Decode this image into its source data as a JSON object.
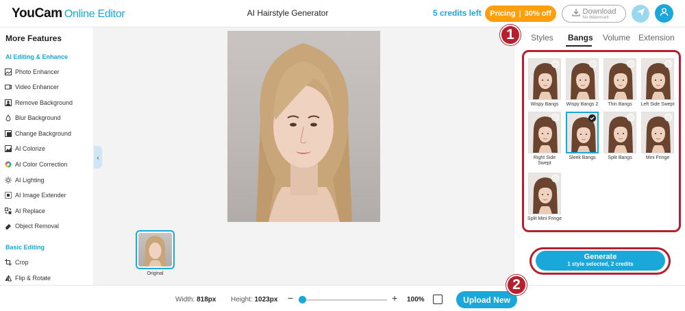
{
  "header": {
    "logo_main": "YouCam",
    "logo_sub": "Online Editor",
    "title": "AI Hairstyle Generator",
    "credits": "5 credits left",
    "pricing_label": "Pricing",
    "pricing_sep": "|",
    "pricing_discount": "30% off",
    "download_label": "Download",
    "download_sub": "No Watermark",
    "icons": {
      "download": "download-icon",
      "send": "send-icon",
      "profile": "user-icon"
    }
  },
  "sidebar": {
    "title": "More Features",
    "sections": [
      {
        "title": "AI Editing & Enhance",
        "items": [
          {
            "label": "Photo Enhancer",
            "icon": "image-enhance-icon"
          },
          {
            "label": "Video Enhancer",
            "icon": "video-enhance-icon"
          },
          {
            "label": "Remove Background",
            "icon": "remove-bg-icon"
          },
          {
            "label": "Blur Background",
            "icon": "blur-drop-icon"
          },
          {
            "label": "Change Background",
            "icon": "change-bg-icon"
          },
          {
            "label": "AI Colorize",
            "icon": "colorize-icon"
          },
          {
            "label": "AI Color Correction",
            "icon": "color-wheel-icon"
          },
          {
            "label": "AI Lighting",
            "icon": "sun-icon"
          },
          {
            "label": "AI Image Extender",
            "icon": "expand-icon"
          },
          {
            "label": "AI Replace",
            "icon": "replace-icon"
          },
          {
            "label": "Object Removal",
            "icon": "eraser-icon"
          }
        ]
      },
      {
        "title": "Basic Editing",
        "items": [
          {
            "label": "Crop",
            "icon": "crop-icon"
          },
          {
            "label": "Flip & Rotate",
            "icon": "flip-icon"
          }
        ]
      }
    ],
    "collapse_icon": "chevron-left-icon"
  },
  "canvas": {
    "thumbnail_label": "Original"
  },
  "panel": {
    "tabs": [
      {
        "label": "Styles",
        "active": false
      },
      {
        "label": "Bangs",
        "active": true
      },
      {
        "label": "Volume",
        "active": false
      },
      {
        "label": "Extension",
        "active": false
      }
    ],
    "styles": [
      {
        "label": "Wispy Bangs",
        "selected": false
      },
      {
        "label": "Wispy Bangs 2",
        "selected": false
      },
      {
        "label": "Thin Bangs",
        "selected": false
      },
      {
        "label": "Left Side Swept",
        "selected": false
      },
      {
        "label": "Right Side Swept",
        "selected": false
      },
      {
        "label": "Sleek Bangs",
        "selected": true
      },
      {
        "label": "Split Bangs",
        "selected": false
      },
      {
        "label": "Mini Fringe",
        "selected": false
      },
      {
        "label": "Split Mini Fringe",
        "selected": false
      }
    ],
    "generate_label": "Generate",
    "generate_sub": "1 style selected, 2 credits"
  },
  "footer": {
    "width_label": "Width:",
    "width_value": "818px",
    "height_label": "Height:",
    "height_value": "1023px",
    "zoom_minus": "−",
    "zoom_plus": "+",
    "zoom_level": "100%",
    "zoom_fraction": 0.0,
    "upload_label": "Upload New",
    "fit_icon": "fit-screen-icon"
  },
  "annotations": {
    "marker_1": "1",
    "marker_2": "2"
  },
  "colors": {
    "accent": "#1aa7d9",
    "pricing": "#ff9f0d",
    "highlight_ring": "#b51f2e"
  }
}
